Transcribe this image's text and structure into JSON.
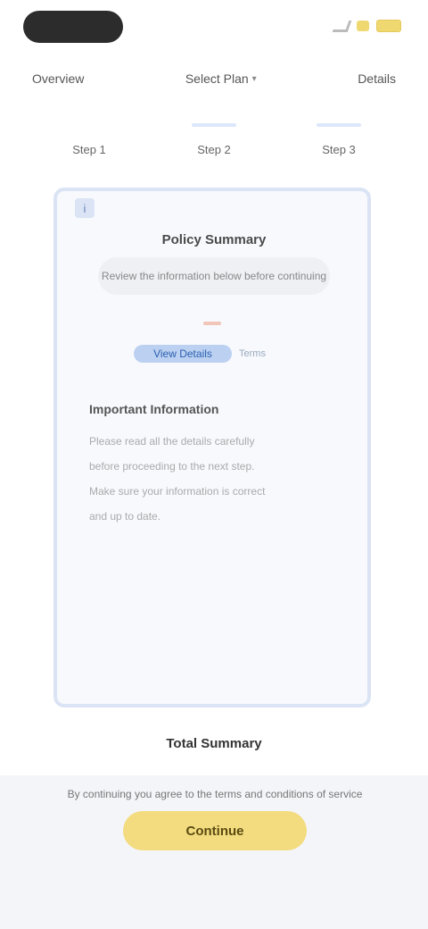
{
  "status_bar": {
    "icons": [
      "signal-icon",
      "battery-icon"
    ],
    "pill_color": "#2c2c2c",
    "battery_color": "#f0d870"
  },
  "top_tabs": [
    {
      "label": "Overview"
    },
    {
      "label": "Select Plan",
      "has_dropdown": true
    },
    {
      "label": "Details"
    }
  ],
  "steps": [
    {
      "label": "Step 1"
    },
    {
      "label": "Step 2"
    },
    {
      "label": "Step 3"
    }
  ],
  "card": {
    "corner_icon": "info-icon",
    "title": "Policy Summary",
    "subtitle": "Review the information below before continuing",
    "link_main": "View Details",
    "link_aux": "Terms",
    "section_title": "Important Information",
    "paragraph_lines": [
      "Please read all the details carefully",
      "before proceeding to the next step.",
      "Make sure your information is correct",
      "and up to date."
    ],
    "accent_color": "#dbe4f4"
  },
  "footer": {
    "title": "Total Summary",
    "terms": "By continuing you agree to the terms and conditions of service",
    "cta_label": "Continue"
  },
  "colors": {
    "cta": "#f3dc7f",
    "link": "#bcd1f1"
  }
}
